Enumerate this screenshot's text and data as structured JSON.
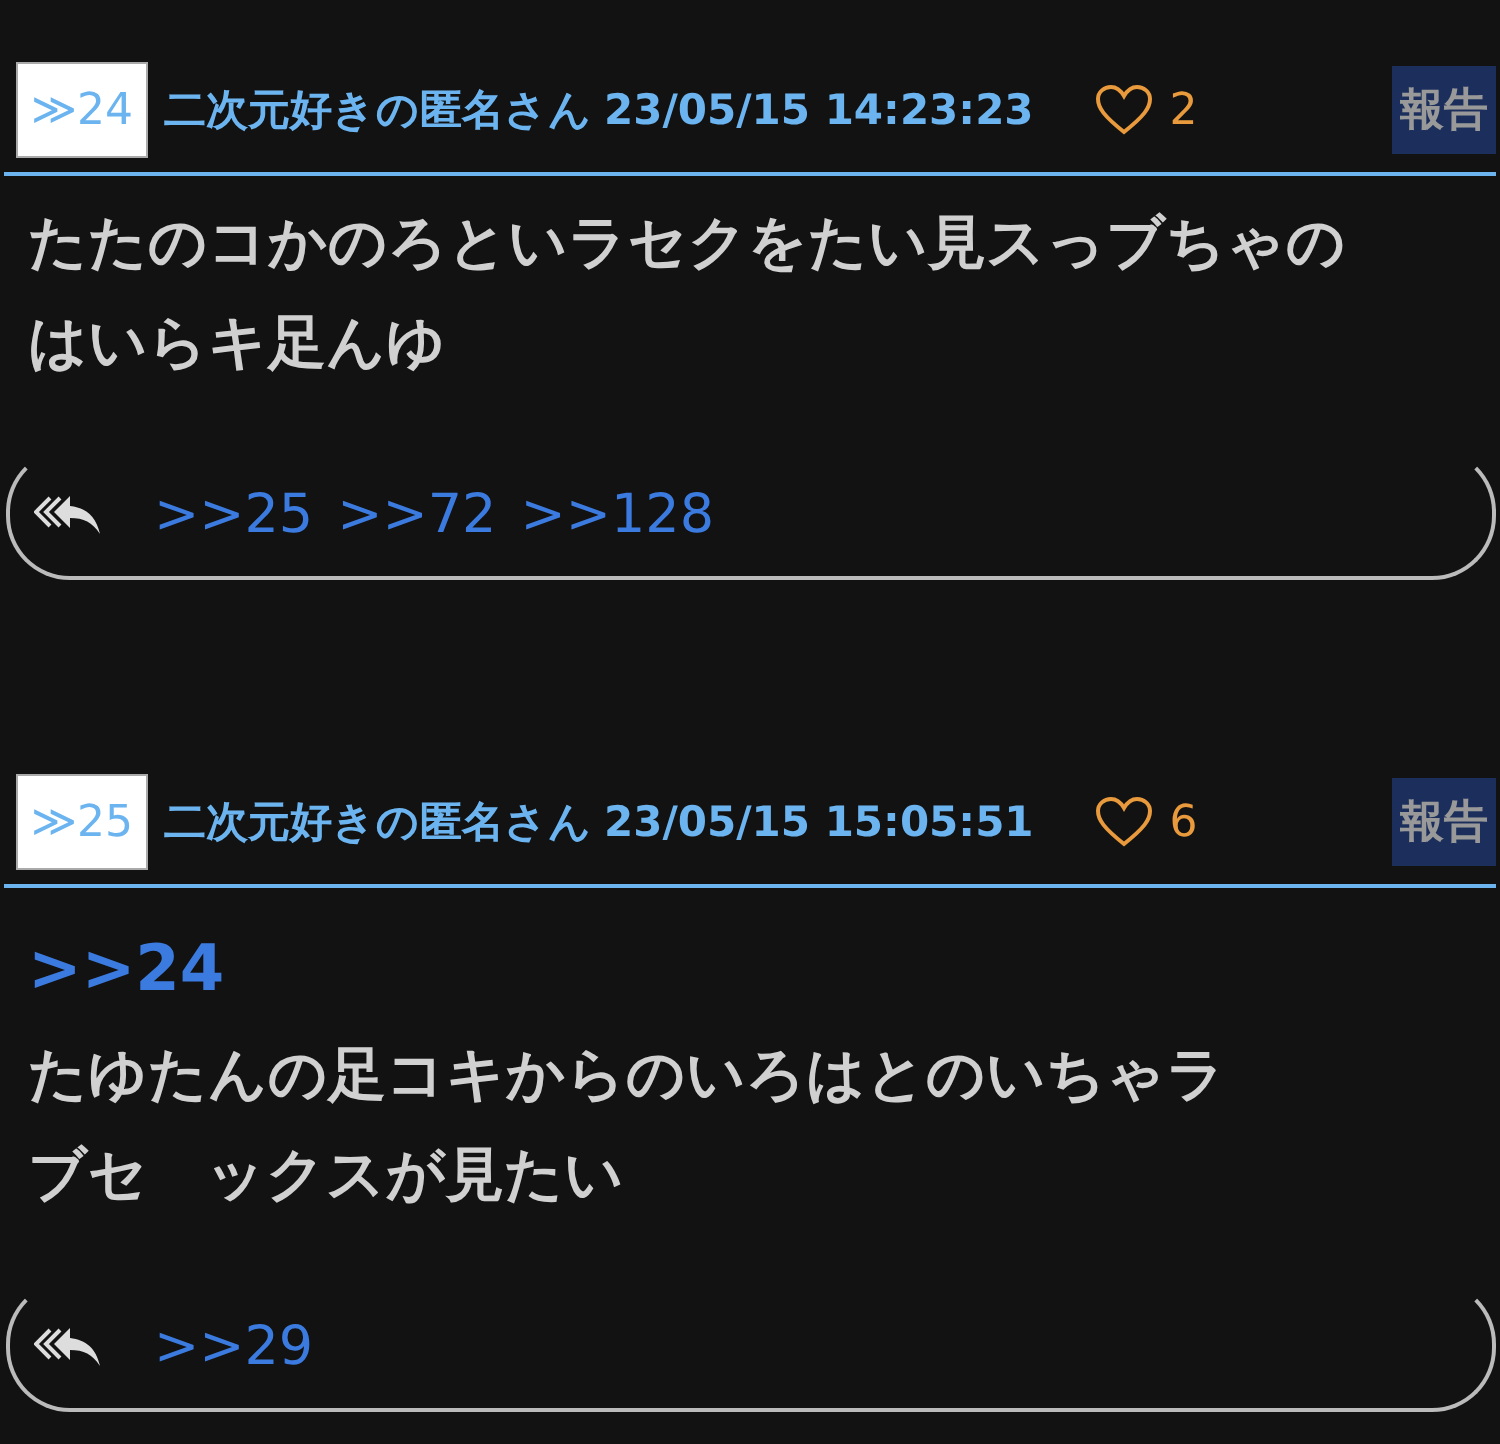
{
  "posts": [
    {
      "number": "≫24",
      "author": "二次元好きの匿名さん",
      "date": "23/05/15 14:23:23",
      "likes": "2",
      "report": "報告",
      "body": [
        "たたのコかのろといラセクをたい見スっブちゃの",
        "はいらキ足んゆ"
      ],
      "replies": [
        ">>25",
        ">>72",
        ">>128"
      ]
    },
    {
      "number": "≫25",
      "author": "二次元好きの匿名さん",
      "date": "23/05/15 15:05:51",
      "likes": "6",
      "report": "報告",
      "anchor": ">>24",
      "body": [
        "たゆたんの足コキからのいろはとのいちゃラ",
        "ブセ　ックスが見たい"
      ],
      "replies": [
        ">>29"
      ]
    }
  ]
}
